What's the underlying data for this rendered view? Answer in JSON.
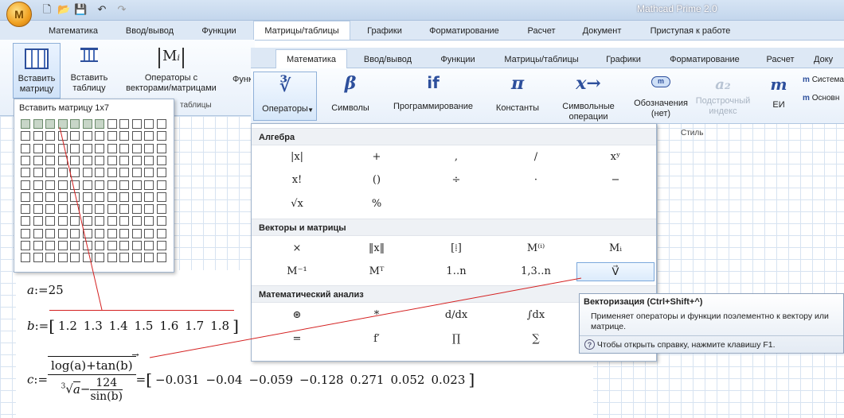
{
  "app": {
    "title": "Mathcad Prime 2.0",
    "logo": "M"
  },
  "quick_access": [
    "new-icon",
    "open-icon",
    "save-icon",
    "undo-icon",
    "redo-icon"
  ],
  "tabs_back": [
    "Математика",
    "Ввод/вывод",
    "Функции",
    "Матрицы/таблицы",
    "Графики",
    "Форматирование",
    "Расчет",
    "Документ",
    "Приступая к работе"
  ],
  "ribbon_back": {
    "insert_matrix": [
      "Вставить",
      "матрицу"
    ],
    "insert_table": [
      "Вставить",
      "таблицу"
    ],
    "vector_ops": [
      "Операторы с",
      "векторами/матрицами"
    ],
    "functions_cut": "Функ",
    "group_label": "таблицы"
  },
  "tabs_front": [
    "Математика",
    "Ввод/вывод",
    "Функции",
    "Матрицы/таблицы",
    "Графики",
    "Форматирование",
    "Расчет",
    "Доку"
  ],
  "ribbon_front": {
    "operators": {
      "symbol": "∛",
      "label": "Операторы"
    },
    "symbols": {
      "symbol": "β",
      "label": "Символы"
    },
    "programming": {
      "symbol": "if",
      "label": "Программирование"
    },
    "constants": {
      "symbol": "π",
      "label": "Константы"
    },
    "symbolic": {
      "symbol": "x→",
      "label": "Символьные операции"
    },
    "labels": {
      "line1": "Обозначения",
      "line2": "(нет)"
    },
    "subscript": {
      "symbol": "a₂",
      "line1": "Подстрочный",
      "line2": "индекс"
    },
    "style_group": "Стиль",
    "units": {
      "symbol": "m",
      "label": "ЕИ"
    },
    "system": "Система",
    "basic": "Основн"
  },
  "matrix_popup": {
    "title": "Вставить матрицу 1x7",
    "rows": 12,
    "cols": 12,
    "highlight_rows": 1,
    "highlight_cols": 7
  },
  "operators_panel": {
    "algebra": {
      "title": "Алгебра",
      "rows": [
        [
          "|x|",
          "+",
          ",",
          "/",
          "xʸ"
        ],
        [
          "x!",
          "()",
          "÷",
          "·",
          "−"
        ],
        [
          "√x",
          "%"
        ]
      ]
    },
    "vectors": {
      "title": "Векторы и матрицы",
      "rows": [
        [
          "×",
          "‖x‖",
          "[⁞]",
          "M⁽ⁱ⁾",
          "Mᵢ"
        ],
        [
          "M⁻¹",
          "Mᵀ",
          "1‥n",
          "1,3‥n",
          "V⃗"
        ]
      ]
    },
    "calculus": {
      "title": "Математический анализ",
      "rows": [
        [
          "⊛",
          "*",
          "d/dx",
          "∫dx",
          ""
        ],
        [
          "=",
          "f′",
          "∏",
          "∑",
          ""
        ]
      ]
    }
  },
  "tooltip": {
    "title": "Векторизация (Ctrl+Shift+^)",
    "body": "Применяет операторы и функции поэлементно к вектору или матрице.",
    "help": "Чтобы открыть справку, нажмите клавишу F1."
  },
  "worksheet": {
    "a_def": {
      "lhs": "a",
      "op": ":=",
      "value": "25"
    },
    "b_def": {
      "lhs": "b",
      "op": ":=",
      "values": [
        "1.2",
        "1.3",
        "1.4",
        "1.5",
        "1.6",
        "1.7",
        "1.8"
      ]
    },
    "c_def": {
      "lhs": "c",
      "op": ":=",
      "numerator": "log(a)+tan(b)",
      "den_root_index": "3",
      "den_root_arg": "a",
      "den_minus": "−",
      "den_frac_num": "124",
      "den_frac_den": "sin(b)",
      "eq": "=",
      "result": [
        "−0.031",
        "−0.04",
        "−0.059",
        "−0.128",
        "0.271",
        "0.052",
        "0.023"
      ]
    }
  },
  "colors": {
    "accent": "#2d4f9c",
    "annotation_line": "#d42020",
    "ribbon_bg": "#e8f0fa"
  }
}
